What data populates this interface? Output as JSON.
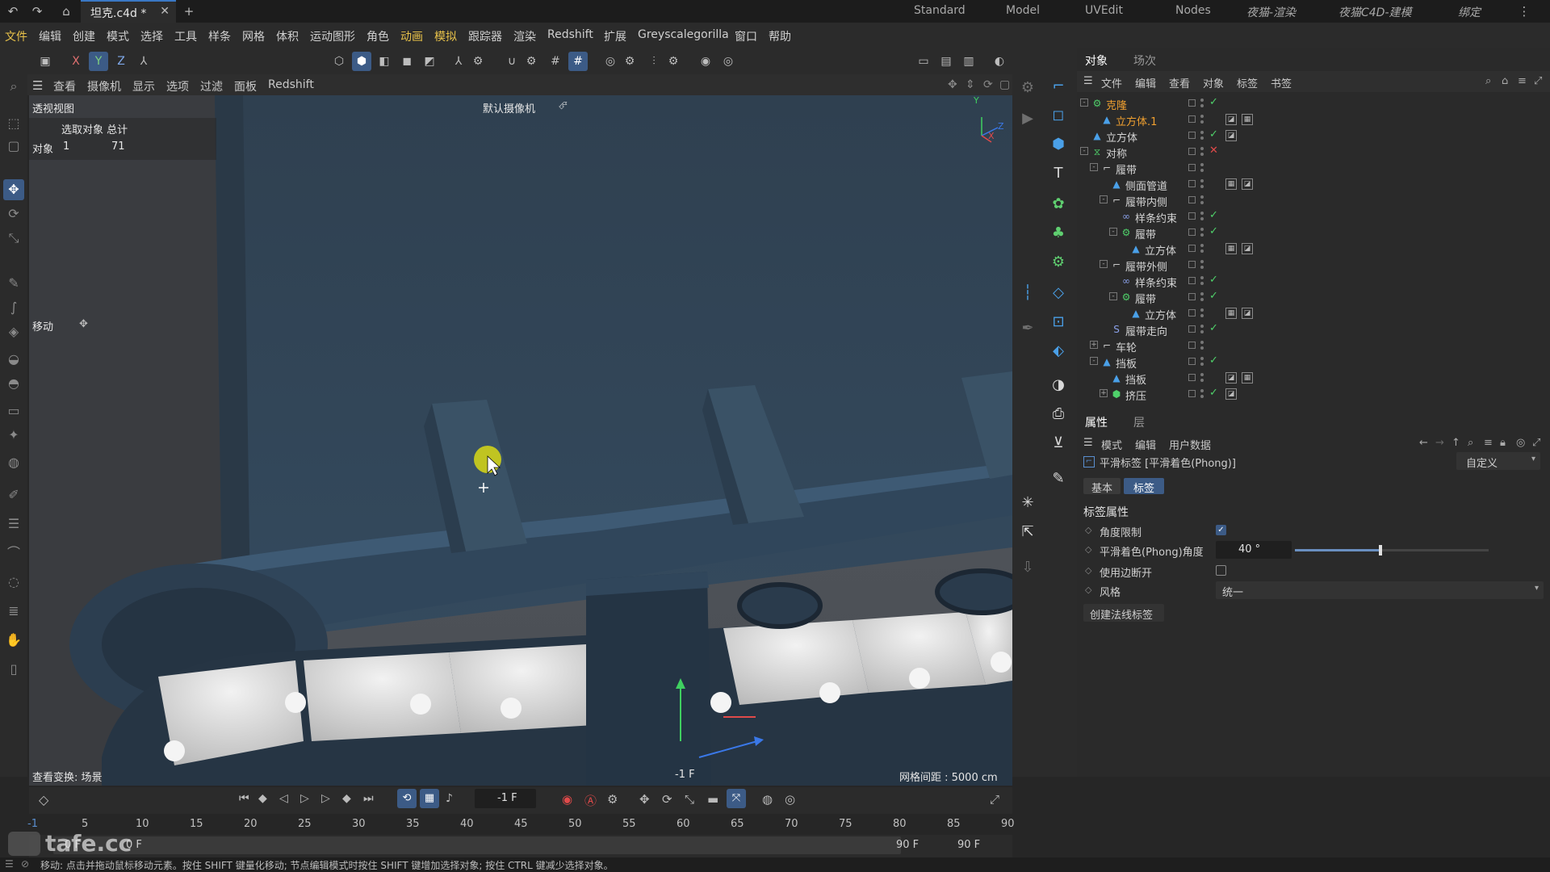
{
  "titlebar": {
    "doc_tab": "坦克.c4d *",
    "layouts": [
      "Standard",
      "Model",
      "UVEdit",
      "Nodes",
      "夜猫-渲染",
      "夜猫C4D-建模",
      "绑定"
    ]
  },
  "menubar": {
    "items": [
      "文件",
      "编辑",
      "创建",
      "模式",
      "选择",
      "工具",
      "样条",
      "网格",
      "体积",
      "运动图形",
      "角色",
      "动画",
      "模拟",
      "跟踪器",
      "渲染",
      "Redshift",
      "扩展",
      "Greyscalegorilla",
      "窗口",
      "帮助"
    ]
  },
  "toolbar": {
    "axis_x": "X",
    "axis_y": "Y",
    "axis_z": "Z"
  },
  "viewport": {
    "menu": [
      "查看",
      "摄像机",
      "显示",
      "选项",
      "过滤",
      "面板",
      "Redshift"
    ],
    "view_name": "透视视图",
    "camera_label": "默认摄像机",
    "info_header": "选取对象 总计",
    "info_row_label": "对象",
    "info_selected": "1",
    "info_total": "71",
    "tool_label": "移动",
    "view_transform": "查看变换: 场景",
    "grid_spacing": "网格间距 : 5000 cm",
    "frame_marker": "-1 F",
    "axis_labels": {
      "y": "Y",
      "z": "Z",
      "x": "X"
    }
  },
  "object_manager": {
    "tabs": [
      "对象",
      "场次"
    ],
    "menu": [
      "文件",
      "编辑",
      "查看",
      "对象",
      "标签",
      "书签"
    ],
    "rows": [
      {
        "name": "克隆",
        "depth": 0,
        "expand": "-",
        "icon": "cloner-icon",
        "check": "green",
        "highlight": true
      },
      {
        "name": "立方体.1",
        "depth": 1,
        "expand": "",
        "icon": "cube-icon",
        "check": "",
        "highlight": true
      },
      {
        "name": "立方体",
        "depth": 0,
        "expand": "",
        "icon": "cube-icon",
        "check": "green",
        "highlight": false
      },
      {
        "name": "对称",
        "depth": 0,
        "expand": "-",
        "icon": "symmetry-icon",
        "check": "red",
        "highlight": false
      },
      {
        "name": "履带",
        "depth": 1,
        "expand": "-",
        "icon": "null-icon",
        "check": "",
        "highlight": false
      },
      {
        "name": "侧面管道",
        "depth": 2,
        "expand": "",
        "icon": "cube-icon",
        "check": "",
        "highlight": false
      },
      {
        "name": "履带内侧",
        "depth": 2,
        "expand": "-",
        "icon": "null-icon",
        "check": "",
        "highlight": false
      },
      {
        "name": "样条约束",
        "depth": 3,
        "expand": "",
        "icon": "spline-wrap-icon",
        "check": "green",
        "highlight": false
      },
      {
        "name": "履带",
        "depth": 3,
        "expand": "-",
        "icon": "cloner-icon",
        "check": "green",
        "highlight": false
      },
      {
        "name": "立方体",
        "depth": 4,
        "expand": "",
        "icon": "cube-icon",
        "check": "",
        "highlight": false
      },
      {
        "name": "履带外侧",
        "depth": 2,
        "expand": "-",
        "icon": "null-icon",
        "check": "",
        "highlight": false
      },
      {
        "name": "样条约束",
        "depth": 3,
        "expand": "",
        "icon": "spline-wrap-icon",
        "check": "green",
        "highlight": false
      },
      {
        "name": "履带",
        "depth": 3,
        "expand": "-",
        "icon": "cloner-icon",
        "check": "green",
        "highlight": false
      },
      {
        "name": "立方体",
        "depth": 4,
        "expand": "",
        "icon": "cube-icon",
        "check": "",
        "highlight": false
      },
      {
        "name": "履带走向",
        "depth": 2,
        "expand": "",
        "icon": "spline-icon",
        "check": "green",
        "highlight": false
      },
      {
        "name": "车轮",
        "depth": 1,
        "expand": "+",
        "icon": "null-icon",
        "check": "",
        "highlight": false
      },
      {
        "name": "挡板",
        "depth": 1,
        "expand": "-",
        "icon": "cube-icon",
        "check": "green",
        "highlight": false
      },
      {
        "name": "挡板",
        "depth": 2,
        "expand": "",
        "icon": "cube-icon",
        "check": "",
        "highlight": false
      },
      {
        "name": "挤压",
        "depth": 2,
        "expand": "+",
        "icon": "extrude-icon",
        "check": "green",
        "highlight": false
      }
    ]
  },
  "attribute_manager": {
    "tabs": [
      "属性",
      "层"
    ],
    "menu": [
      "模式",
      "编辑",
      "用户数据"
    ],
    "title": "平滑标签 [平滑着色(Phong)]",
    "preset": "自定义",
    "subtabs": [
      "基本",
      "标签"
    ],
    "section": "标签属性",
    "angle_limit_label": "角度限制",
    "phong_angle_label": "平滑着色(Phong)角度",
    "phong_angle_value": "40 °",
    "phong_angle_fraction": 0.44,
    "use_edge_breaks_label": "使用边断开",
    "style_label": "风格",
    "style_value": "统一",
    "create_normal_tag": "创建法线标签"
  },
  "timeline": {
    "current_frame": "-1 F",
    "ticks": [
      "-1",
      "5",
      "10",
      "15",
      "20",
      "25",
      "30",
      "35",
      "40",
      "45",
      "50",
      "55",
      "60",
      "65",
      "70",
      "75",
      "80",
      "85",
      "90"
    ],
    "range_start": "0 F",
    "range_start2": "0 F",
    "range_end": "90 F",
    "range_end2": "90 F"
  },
  "status": {
    "text": "移动: 点击并拖动鼠标移动元素。按住 SHIFT 键量化移动; 节点编辑模式时按住 SHIFT 键增加选择对象; 按住 CTRL 键减少选择对象。"
  },
  "watermark": "tafe.cc"
}
